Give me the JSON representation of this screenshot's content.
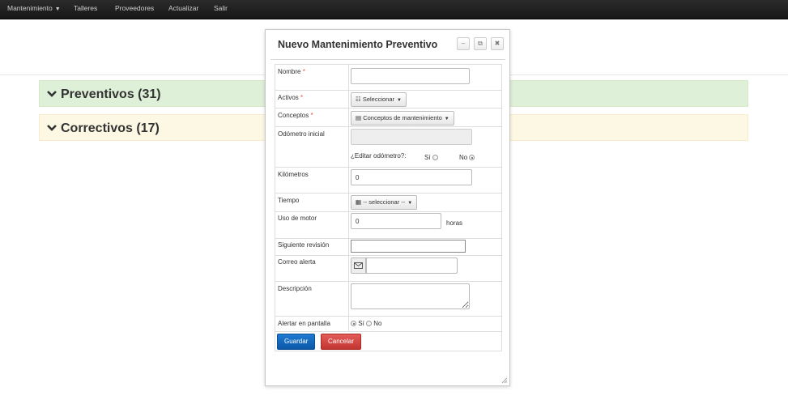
{
  "navbar": {
    "items": [
      {
        "label": "Mantenimiento",
        "has_caret": true
      },
      {
        "label": "Talleres"
      },
      {
        "label": "Proveedores"
      },
      {
        "label": "Actualizar"
      },
      {
        "label": "Salir"
      }
    ]
  },
  "panels": [
    {
      "label": "Preventivos (31)",
      "color": "#dff0d8"
    },
    {
      "label": "Correctivos (17)",
      "color": "#fcf8e3"
    }
  ],
  "dialog": {
    "title": "Nuevo Mantenimiento Preventivo",
    "buttons": {
      "minimize": "–",
      "popout": "⧉",
      "close": "✖"
    },
    "form": {
      "required_mark": "*",
      "nombre": {
        "label": "Nombre",
        "value": ""
      },
      "activos": {
        "label": "Activos",
        "button": "Seleccionar"
      },
      "conceptos": {
        "label": "Conceptos",
        "button": "Conceptos de mantenimiento"
      },
      "odometro": {
        "label": "Odómetro inicial",
        "value": "",
        "edit_question": "¿Editar odómetro?:",
        "si": "Sí",
        "no": "No",
        "selected": "No"
      },
      "kilometros": {
        "label": "Kilómetros",
        "value": "0"
      },
      "tiempo": {
        "label": "Tiempo",
        "button": "-- seleccionar --"
      },
      "uso_motor": {
        "label": "Uso de motor",
        "value": "0",
        "unit": "horas"
      },
      "siguiente_revision": {
        "label": "Siguiente revisión",
        "value": ""
      },
      "correo_alerta": {
        "label": "Correo alerta",
        "value": ""
      },
      "descripcion": {
        "label": "Descripción",
        "value": ""
      },
      "alertar_pantalla": {
        "label": "Alertar en pantalla",
        "si": "Sí",
        "no": "No",
        "selected": "Sí"
      }
    },
    "actions": {
      "save": "Guardar",
      "cancel": "Cancelar"
    }
  },
  "colors": {
    "primary": "#0c58a8",
    "danger": "#c23531",
    "navbar": "#1f1f1f"
  }
}
